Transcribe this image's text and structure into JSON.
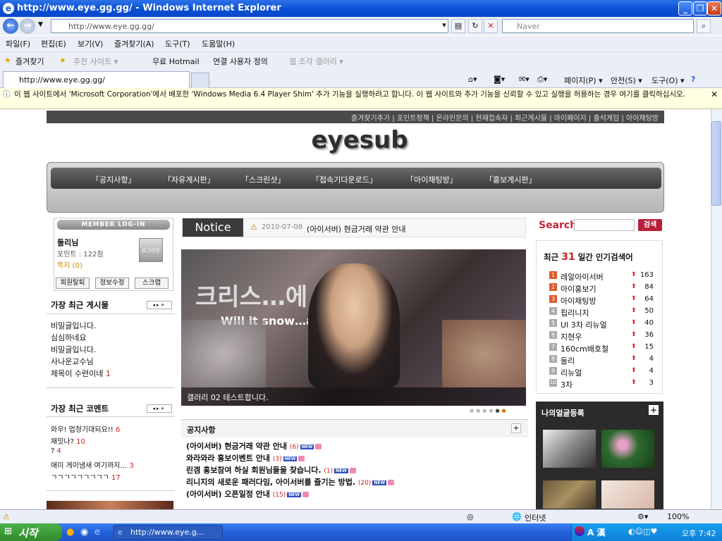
{
  "window": {
    "title": "http://www.eye.gg.gg/ - Windows Internet Explorer"
  },
  "address": {
    "url": "http://www.eye.gg.gg/",
    "search_placeholder": "Naver"
  },
  "menu": [
    "파일(F)",
    "편집(E)",
    "보기(V)",
    "즐겨찾기(A)",
    "도구(T)",
    "도움말(H)"
  ],
  "favorites": {
    "label": "즐겨찾기",
    "items": [
      "추천 사이트 ▾",
      "무료 Hotmail",
      "연결 사용자 정의",
      "웹 조각 갤러리 ▾"
    ]
  },
  "tab": {
    "title": "http://www.eye.gg.gg/"
  },
  "commandbar": {
    "page": "페이지(P) ▾",
    "safety": "안전(S) ▾",
    "tools": "도구(O) ▾",
    "help": "?"
  },
  "infobar": {
    "text": "이 웹 사이트에서 'Microsoft Corporation'에서 배포한 'Windows Media 6.4 Player Shim' 추가 기능을 실행하려고 합니다. 이 웹 사이트와 추가 기능을 신뢰할 수 있고 실행을 허용하는 경우 여기를 클릭하십시오."
  },
  "site": {
    "topnav": "즐겨찾기추가 | 포인트정책 | 온라인문의 | 현재접속자 | 최근게시물 | 마이페이지 | 출석게임 | 아이채팅방",
    "logo": "eyesub",
    "gnb": [
      "「공지사항」",
      "「자유게시판」",
      "「스크린샷」",
      "「접속기다운로드」",
      "「아이채팅방」",
      "「홍보게시판」"
    ],
    "login": {
      "header": "MEMBER LOG-IN",
      "user": "둘리님",
      "points": "포인트 : 122점",
      "memo": "쪽지 (0)",
      "logout": "로그아웃",
      "buttons": [
        "회원탈퇴",
        "정보수정",
        "스크랩"
      ]
    },
    "recent_posts": {
      "title": "가장 최근 게시물",
      "items": [
        {
          "text": "비밀글입니다.",
          "count": ""
        },
        {
          "text": "심심하네요",
          "count": ""
        },
        {
          "text": "비밀글입니다.",
          "count": ""
        },
        {
          "text": "사나운교수님",
          "count": ""
        },
        {
          "text": "제목이 수련이네",
          "count": "1"
        }
      ]
    },
    "recent_comments": {
      "title": "가장 최근 코멘트",
      "items": [
        {
          "text": "와우! 업청기대되요!!",
          "count": "6"
        },
        {
          "text": "재밋나?",
          "count": "10"
        },
        {
          "text": "?",
          "count": "4"
        },
        {
          "text": "애미 게이냄새 여기까지…",
          "count": "3"
        },
        {
          "text": "ㄱㄱㄱㄱㄱㄱㄱㄱㄱ",
          "count": "17"
        }
      ]
    },
    "notice_bar": {
      "label": "Notice",
      "date": "2010-07-08",
      "text": "(아이서버) 현금거래 약관 안내"
    },
    "gallery": {
      "caption": "갤러리 02 테스트합니다.",
      "overlay_text": "Will it snow…as?",
      "overlay_korean": "크리스…에 눈이올"
    },
    "notices": {
      "title": "공지사항",
      "items": [
        {
          "text": "(아이서버) 현금거래 약관 안내",
          "count": "(6)"
        },
        {
          "text": "와라와라 홍보이벤트 안내",
          "count": "(3)"
        },
        {
          "text": "린겜 홍보참여 하실 회원님들을 찾습니다.",
          "count": "(1)"
        },
        {
          "text": "리니지의 새로운 패러다임, 아이서버를 즐기는 방법.",
          "count": "(20)"
        },
        {
          "text": "(아이서버) 오픈일정 안내",
          "count": "(15)"
        }
      ]
    },
    "search": {
      "label": "Search",
      "button": "검색"
    },
    "popular": {
      "title_pre": "최근",
      "days": "31",
      "title_post": "일간 인기검색어",
      "items": [
        {
          "rank": "1",
          "word": "레알아이서버",
          "n": "163"
        },
        {
          "rank": "2",
          "word": "아이홍보기",
          "n": "84"
        },
        {
          "rank": "3",
          "word": "아이채팅방",
          "n": "64"
        },
        {
          "rank": "4",
          "word": "핍리니지",
          "n": "50"
        },
        {
          "rank": "5",
          "word": "UI 3차 리뉴얼",
          "n": "40"
        },
        {
          "rank": "6",
          "word": "지현우",
          "n": "36"
        },
        {
          "rank": "7",
          "word": "160cm배호철",
          "n": "15"
        },
        {
          "rank": "8",
          "word": "둘리",
          "n": "4"
        },
        {
          "rank": "9",
          "word": "리뉴얼",
          "n": "4"
        },
        {
          "rank": "10",
          "word": "3차",
          "n": "3"
        }
      ]
    },
    "faces": {
      "title": "나의얼굴등록"
    }
  },
  "statusbar": {
    "zone": "인터넷",
    "zoom": "100%"
  },
  "taskbar": {
    "start": "시작",
    "task": "http://www.eye.g...",
    "clock": "오후 7:42"
  }
}
